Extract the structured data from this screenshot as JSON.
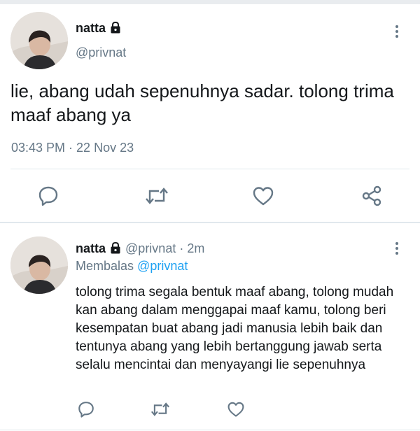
{
  "tweet": {
    "author_name": "natta",
    "author_handle": "@privnat",
    "text": "lie, abang udah sepenuhnya sadar. tolong trima maaf abang ya",
    "time": "03:43 PM",
    "separator": " · ",
    "date": "22 Nov 23",
    "icons": [
      "lock-icon",
      "more-options-icon",
      "reply-icon",
      "retweet-icon",
      "like-icon",
      "share-icon"
    ]
  },
  "reply": {
    "author_name": "natta",
    "author_handle": "@privnat",
    "time_ago": "· 2m",
    "replying_label": "Membalas",
    "replying_to": "@privnat",
    "text": "tolong trima segala bentuk maaf abang, tolong mudah kan abang dalam menggapai maaf kamu, tolong beri kesempatan buat abang jadi manusia lebih baik dan tentunya abang yang lebih bertanggung jawab serta selalu mencintai dan menyayangi lie sepenuhnya",
    "icons": [
      "lock-icon",
      "more-options-icon",
      "reply-icon",
      "retweet-icon",
      "like-icon"
    ]
  },
  "colors": {
    "text": "#14171a",
    "secondary": "#657786",
    "link": "#1da1f2",
    "divider": "#e1e8ed"
  }
}
